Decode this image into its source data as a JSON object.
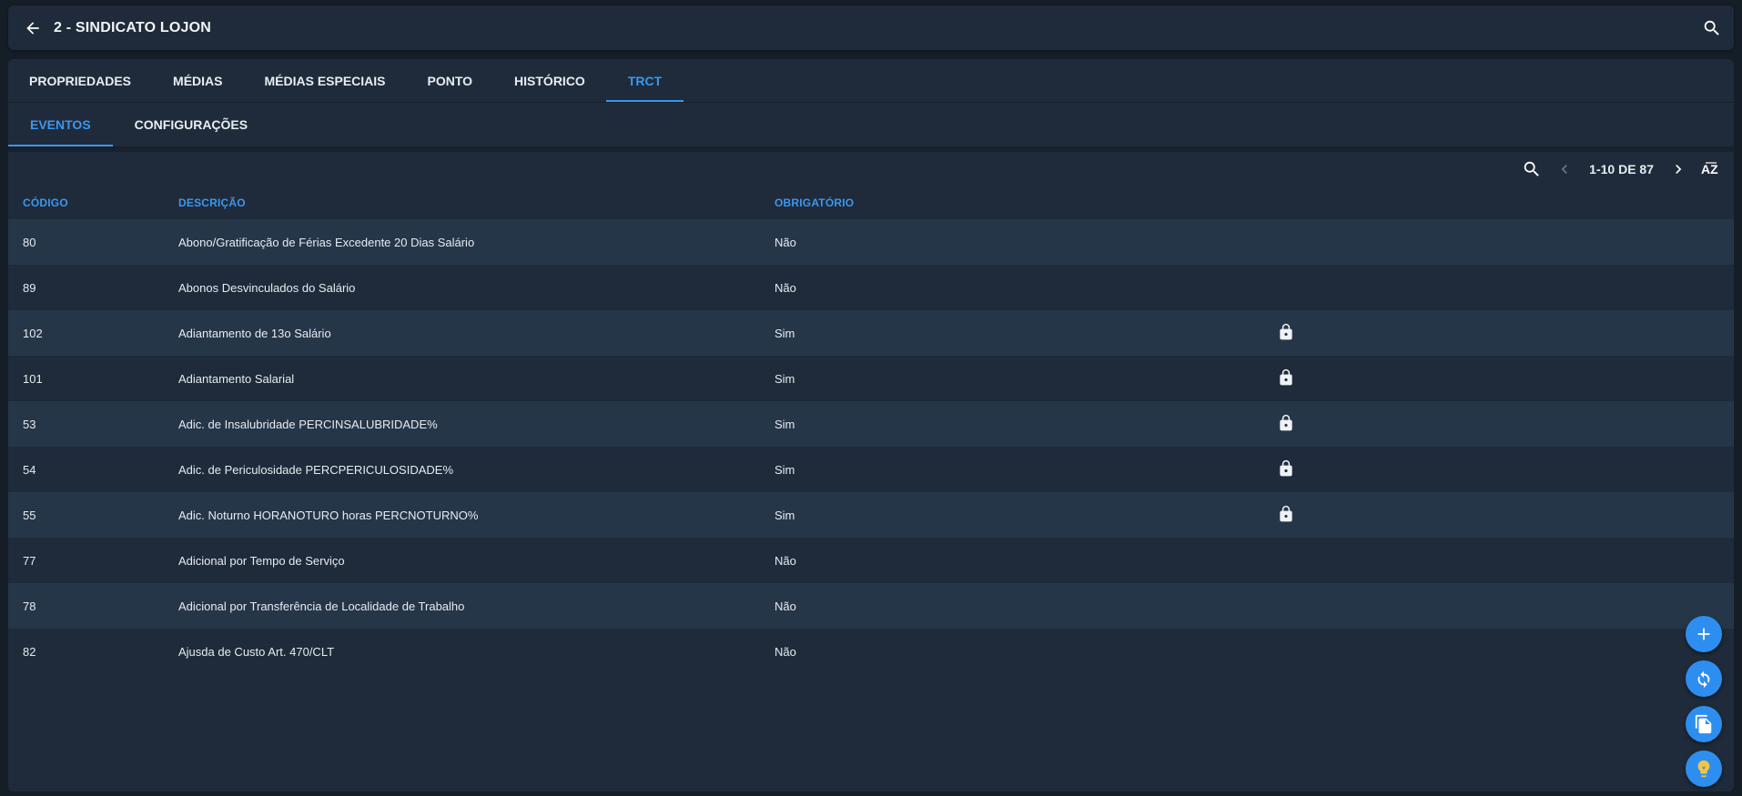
{
  "header": {
    "title": "2 - SINDICATO LOJON",
    "back_icon": "arrow-left-icon",
    "search_icon": "search-icon"
  },
  "tabs": [
    {
      "label": "PROPRIEDADES",
      "active": false
    },
    {
      "label": "MÉDIAS",
      "active": false
    },
    {
      "label": "MÉDIAS ESPECIAIS",
      "active": false
    },
    {
      "label": "PONTO",
      "active": false
    },
    {
      "label": "HISTÓRICO",
      "active": false
    },
    {
      "label": "TRCT",
      "active": true
    }
  ],
  "subtabs": [
    {
      "label": "EVENTOS",
      "active": true
    },
    {
      "label": "CONFIGURAÇÕES",
      "active": false
    }
  ],
  "toolbar": {
    "pager_label": "1-10 DE 87",
    "sort_label": "AZ"
  },
  "table": {
    "columns": [
      "CÓDIGO",
      "DESCRIÇÃO",
      "OBRIGATÓRIO"
    ],
    "rows": [
      {
        "code": "80",
        "description": "Abono/Gratificação de Férias Excedente 20 Dias Salário",
        "required": "Não",
        "locked": false
      },
      {
        "code": "89",
        "description": "Abonos Desvinculados do Salário",
        "required": "Não",
        "locked": false
      },
      {
        "code": "102",
        "description": "Adiantamento de 13o Salário",
        "required": "Sim",
        "locked": true
      },
      {
        "code": "101",
        "description": "Adiantamento Salarial",
        "required": "Sim",
        "locked": true
      },
      {
        "code": "53",
        "description": "Adic. de Insalubridade PERCINSALUBRIDADE%",
        "required": "Sim",
        "locked": true
      },
      {
        "code": "54",
        "description": "Adic. de Periculosidade PERCPERICULOSIDADE%",
        "required": "Sim",
        "locked": true
      },
      {
        "code": "55",
        "description": "Adic. Noturno HORANOTURO horas PERCNOTURNO%",
        "required": "Sim",
        "locked": true
      },
      {
        "code": "77",
        "description": "Adicional por Tempo de Serviço",
        "required": "Não",
        "locked": false
      },
      {
        "code": "78",
        "description": "Adicional por Transferência de Localidade de Trabalho",
        "required": "Não",
        "locked": false
      },
      {
        "code": "82",
        "description": "Ajusda de Custo Art. 470/CLT",
        "required": "Não",
        "locked": false
      }
    ]
  },
  "fabs": [
    "plus-icon",
    "refresh-icon",
    "copy-icon",
    "lightbulb-icon"
  ],
  "colors": {
    "accent": "#3b97f0",
    "background": "#151d27",
    "surface": "#1f2b3a",
    "row_alt": "#263649"
  }
}
